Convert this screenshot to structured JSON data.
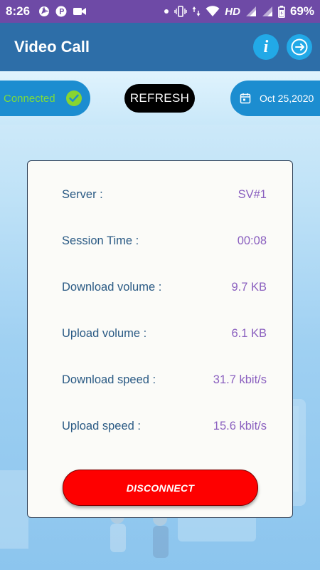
{
  "status_bar": {
    "time": "8:26",
    "network": "HD",
    "battery": "69%",
    "left_icons": [
      "aperture-icon",
      "p-icon",
      "video-icon"
    ],
    "right_icons": [
      "dot-icon",
      "vibrate-icon",
      "data-arrows-icon",
      "wifi-icon",
      "signal-icon",
      "signal-icon",
      "battery-icon"
    ]
  },
  "app_bar": {
    "title": "Video Call",
    "info_icon": "info-icon",
    "exit_icon": "exit-icon"
  },
  "toolbar": {
    "status_label": "Connected",
    "refresh_label": "REFRESH",
    "date_label": "Oct 25,2020"
  },
  "stats": [
    {
      "label": "Server :",
      "value": "SV#1"
    },
    {
      "label": "Session Time :",
      "value": "00:08"
    },
    {
      "label": "Download volume :",
      "value": "9.7 KB"
    },
    {
      "label": "Upload volume :",
      "value": "6.1 KB"
    },
    {
      "label": "Download speed :",
      "value": "31.7 kbit/s"
    },
    {
      "label": "Upload speed :",
      "value": "15.6 kbit/s"
    }
  ],
  "disconnect_label": "DISCONNECT",
  "colors": {
    "status_bar": "#6e4aa6",
    "app_bar": "#2d6ea8",
    "accent_blue": "#1c8dd0",
    "connected_green": "#7ddc3b",
    "disconnect_red": "#fe0000",
    "stat_label": "#2a5a84",
    "stat_value": "#8a5fbf"
  }
}
